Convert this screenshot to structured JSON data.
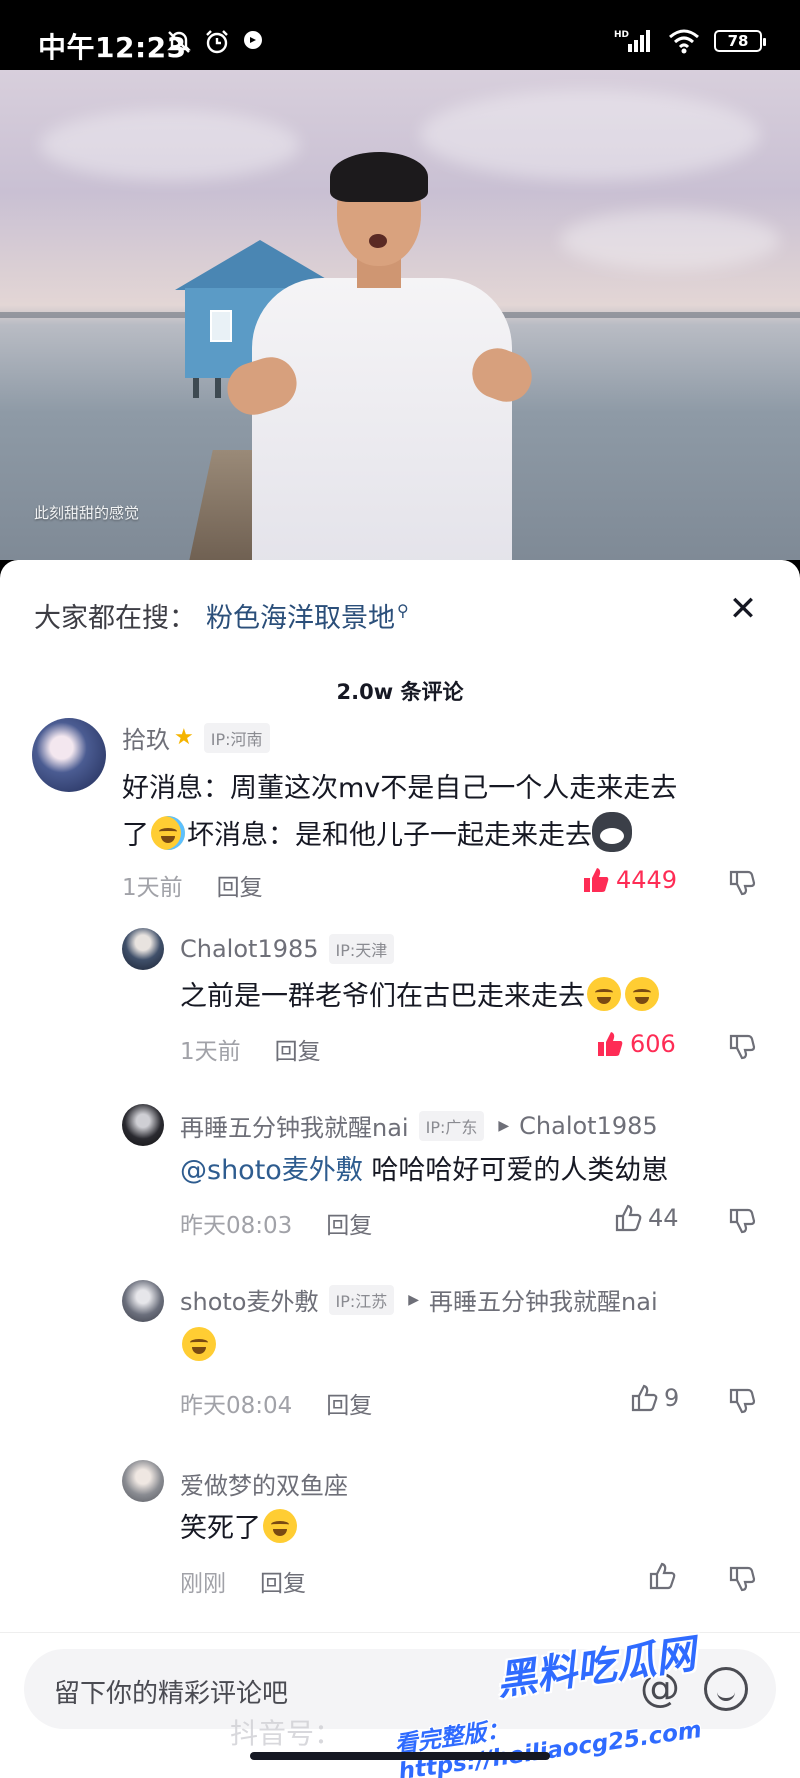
{
  "status_bar": {
    "time": "中午12:23",
    "battery": "78",
    "network": "HD"
  },
  "video": {
    "caption": "此刻甜甜的感觉"
  },
  "hot_search": {
    "prefix": "大家都在搜：",
    "term": "粉色海洋取景地"
  },
  "comment_count": "2.0w 条评论",
  "comments": [
    {
      "username": "拾玖",
      "ip": "IP:河南",
      "text_a": "好消息：周董这次mv不是自己一个人走来走去",
      "text_b": "了",
      "text_c": "坏消息：是和他儿子一起走来走去",
      "time": "1天前",
      "reply": "回复",
      "likes": "4449"
    },
    {
      "username": "Chalot1985",
      "ip": "IP:天津",
      "text": "之前是一群老爷们在古巴走来走去",
      "time": "1天前",
      "reply": "回复",
      "likes": "606"
    },
    {
      "username": "再睡五分钟我就醒nai",
      "ip": "IP:广东",
      "reply_to": "Chalot1985",
      "mention": "@shoto麦外敷",
      "text": " 哈哈哈好可爱的人类幼崽",
      "time": "昨天08:03",
      "reply": "回复",
      "likes": "44"
    },
    {
      "username": "shoto麦外敷",
      "ip": "IP:江苏",
      "reply_to": "再睡五分钟我就醒nai",
      "time": "昨天08:04",
      "reply": "回复",
      "likes": "9"
    },
    {
      "username": "爱做梦的双鱼座",
      "text": "笑死了",
      "time": "刚刚",
      "reply": "回复"
    }
  ],
  "input": {
    "placeholder": "留下你的精彩评论吧"
  },
  "douyin_id": "抖音号：",
  "watermark": {
    "title": "黑料吃瓜网",
    "url": "看完整版：https://heiliaocg25.com"
  },
  "colors": {
    "like_active": "#fe2c55",
    "link": "#2e5c8f",
    "watermark": "#2f6bff"
  }
}
